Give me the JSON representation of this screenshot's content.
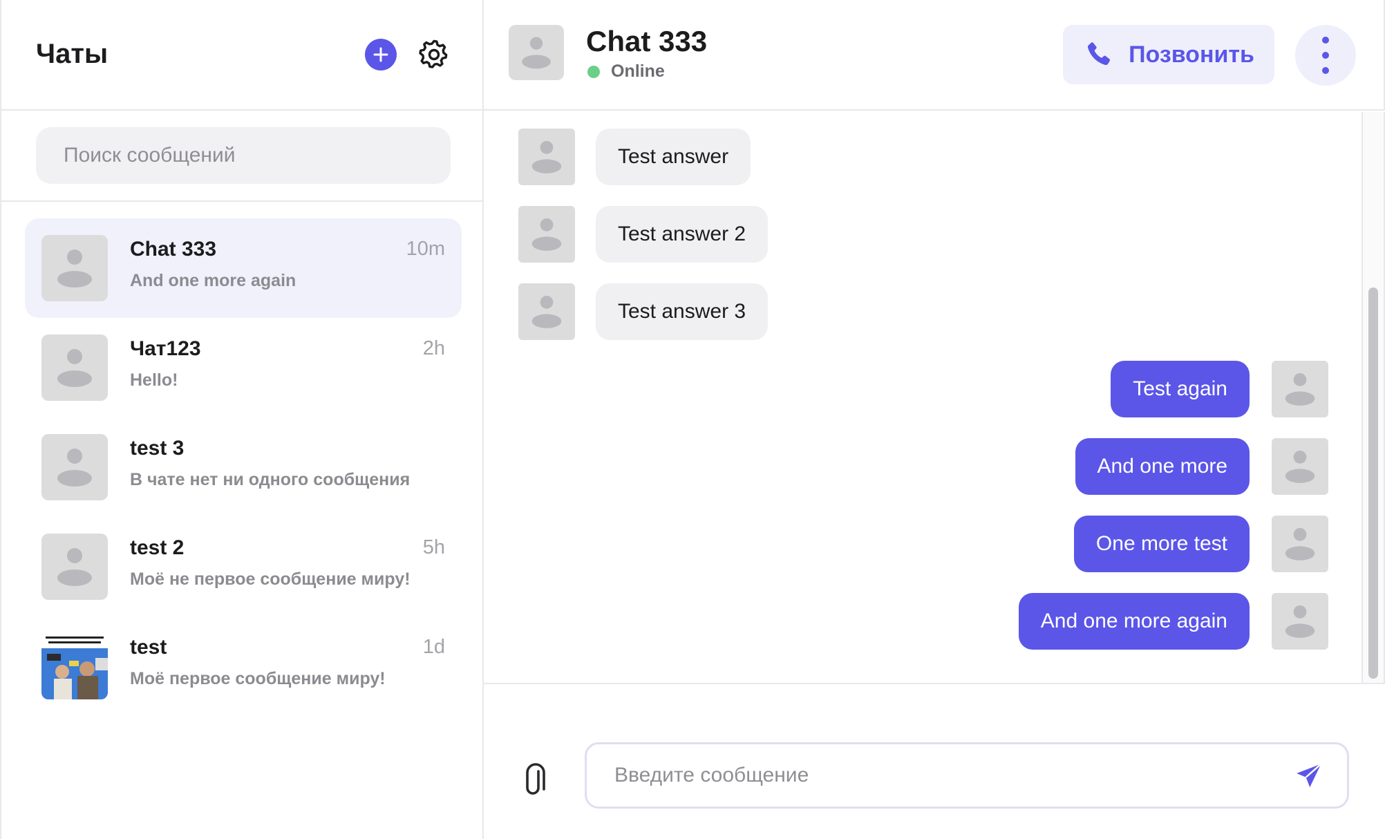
{
  "sidebar": {
    "title": "Чаты",
    "search_placeholder": "Поиск сообщений",
    "chats": [
      {
        "name": "Chat 333",
        "time": "10m",
        "preview": "And one more again",
        "active": true
      },
      {
        "name": "Чат123",
        "time": "2h",
        "preview": "Hello!"
      },
      {
        "name": "test 3",
        "time": "",
        "preview": "В чате нет ни одного сообщения"
      },
      {
        "name": "test 2",
        "time": "5h",
        "preview": "Моё не первое сообщение миру!"
      },
      {
        "name": "test",
        "time": "1d",
        "preview": "Моё первое сообщение миру!"
      }
    ]
  },
  "header": {
    "title": "Chat 333",
    "status": "Online",
    "call_label": "Позвонить"
  },
  "messages": [
    {
      "text": "Test answer",
      "direction": "in"
    },
    {
      "text": "Test answer 2",
      "direction": "in"
    },
    {
      "text": "Test answer 3",
      "direction": "in"
    },
    {
      "text": "Test again",
      "direction": "out"
    },
    {
      "text": "And one more",
      "direction": "out"
    },
    {
      "text": "One more test",
      "direction": "out"
    },
    {
      "text": "And one more again",
      "direction": "out"
    }
  ],
  "composer": {
    "placeholder": "Введите сообщение"
  },
  "colors": {
    "accent": "#5b56e8",
    "accent_light": "#efeffc",
    "online": "#6bcf8a",
    "bubble_in": "#f0f0f2",
    "avatar_placeholder": "#dcdcdc"
  },
  "icons": {
    "add": "plus-icon",
    "settings": "gear-icon",
    "call": "phone-icon",
    "more": "more-vertical-icon",
    "attach": "paperclip-icon",
    "send": "send-icon",
    "avatar": "user-placeholder-icon"
  }
}
